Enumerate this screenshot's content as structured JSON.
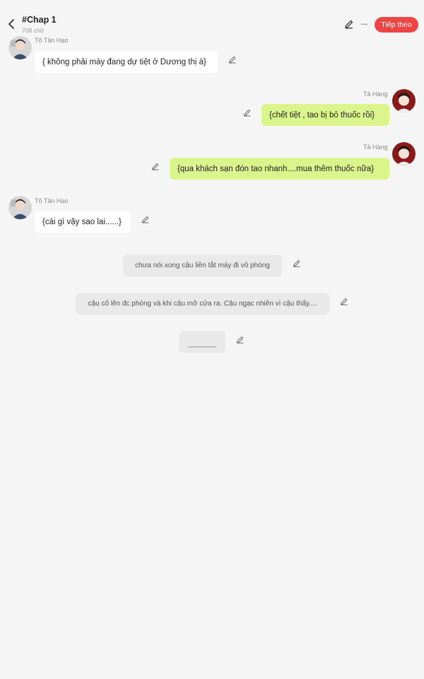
{
  "header": {
    "title": "#Chap 1",
    "word_count": "708 chữ",
    "next_label": "Tiếp theo",
    "more_label": "···"
  },
  "messages": [
    {
      "type": "left",
      "sender": "Tô Tân Hạo",
      "text": "{ không phải mày đang dự tiệt ở Dương thị à}"
    },
    {
      "type": "right",
      "sender": "Tả Hàng",
      "text": "{chết tiệt , tao bị bỏ thuốc rồi}"
    },
    {
      "type": "right",
      "sender": "Tả Hàng",
      "text": "{qua khách sạn đón tao nhanh....mua thêm thuốc nữa}"
    },
    {
      "type": "left",
      "sender": "Tô Tân Hạo",
      "text": "{cái gì vậy sao lai......}"
    }
  ],
  "narrations": [
    {
      "text": "chưa nói xong cậu liền tắt máy đi vô phòng"
    },
    {
      "text": "cậu cố lên đc phòng và khi cậu mở cửa ra. Cậu ngạc nhiên vì cậu thấy...."
    }
  ],
  "colors": {
    "accent": "#ee4444",
    "right_bubble": "#d9f58c",
    "left_bubble": "#ffffff",
    "narration_bg": "#e9e9e9",
    "background": "#f5f5f5"
  },
  "icons": [
    "back-arrow-icon",
    "pencil-icon",
    "more-icon",
    "avatar-to-tan-hao",
    "avatar-ta-hang"
  ]
}
